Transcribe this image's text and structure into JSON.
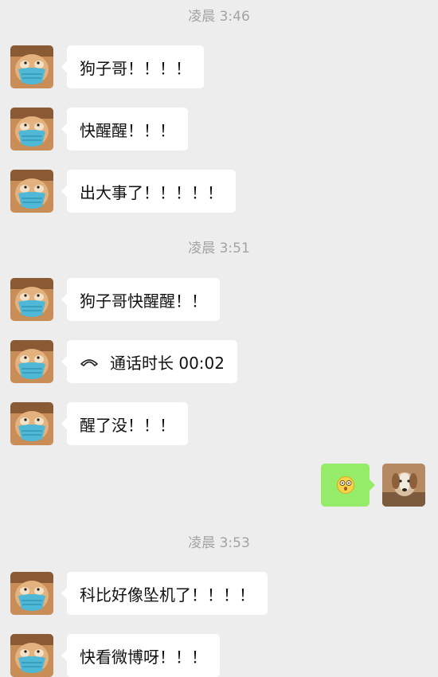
{
  "chat": {
    "timestamps": [
      "凌晨 3:46",
      "凌晨 3:51",
      "凌晨 3:53"
    ],
    "messages": [
      {
        "side": "left",
        "text": "狗子哥！！！！"
      },
      {
        "side": "left",
        "text": "快醒醒！！！"
      },
      {
        "side": "left",
        "text": "出大事了！！！！！"
      },
      {
        "side": "left",
        "text": "狗子哥快醒醒！！"
      },
      {
        "side": "left",
        "type": "call",
        "text": "通话时长 00:02",
        "icon": "phone-hangup-icon"
      },
      {
        "side": "left",
        "text": "醒了没！！！"
      },
      {
        "side": "right",
        "type": "emoji",
        "icon": "dizzy-face-emoji-icon"
      },
      {
        "side": "left",
        "text": "科比好像坠机了！！！！"
      },
      {
        "side": "left",
        "text": "快看微博呀！！！"
      }
    ]
  },
  "colors": {
    "background": "#ededed",
    "incoming_bubble": "#ffffff",
    "outgoing_bubble": "#95ec69",
    "timestamp_text": "#a3a3a3",
    "message_text": "#111111"
  }
}
